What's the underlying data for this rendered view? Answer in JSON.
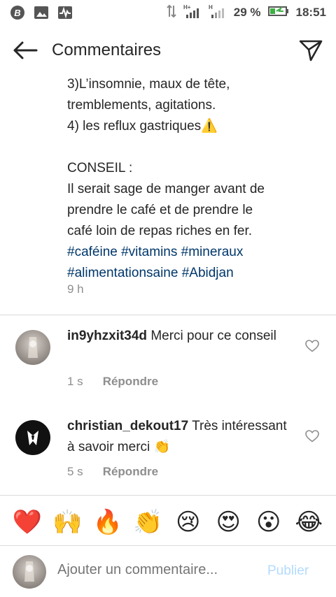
{
  "status_bar": {
    "battery_percent": "29 %",
    "time": "18:51",
    "signal_label_1": "H+",
    "signal_label_2": "H"
  },
  "header": {
    "title": "Commentaires"
  },
  "caption": {
    "lines": [
      "3)L’insomnie, maux de tête,",
      "tremblements, agitations.",
      "4) les reflux gastriques⚠️",
      "CONSEIL :",
      "Il serait sage de manger avant de",
      "prendre le café et de prendre le",
      "café loin de repas riches en fer."
    ],
    "hashtags_line1": "#caféine #vitamins #mineraux",
    "hashtags_line2": "#alimentationsaine #Abidjan",
    "time": "9 h"
  },
  "comments": [
    {
      "username": "in9yhzxit34d",
      "text": " Merci pour ce conseil",
      "time": "1 s",
      "reply_label": "Répondre"
    },
    {
      "username": "christian_dekout17",
      "text": " Très intéressant à savoir merci 👏",
      "time": "5 s",
      "reply_label": "Répondre"
    }
  ],
  "emoji_bar": [
    "❤️",
    "🙌",
    "🔥",
    "👏",
    "😢",
    "😍",
    "😮",
    "😂"
  ],
  "input": {
    "placeholder": "Ajouter un commentaire...",
    "publish_label": "Publier"
  },
  "colors": {
    "hashtag": "#00376b",
    "meta_gray": "#8e8e8e",
    "publish_disabled": "#b3dbff",
    "divider": "#dbdbdb"
  }
}
